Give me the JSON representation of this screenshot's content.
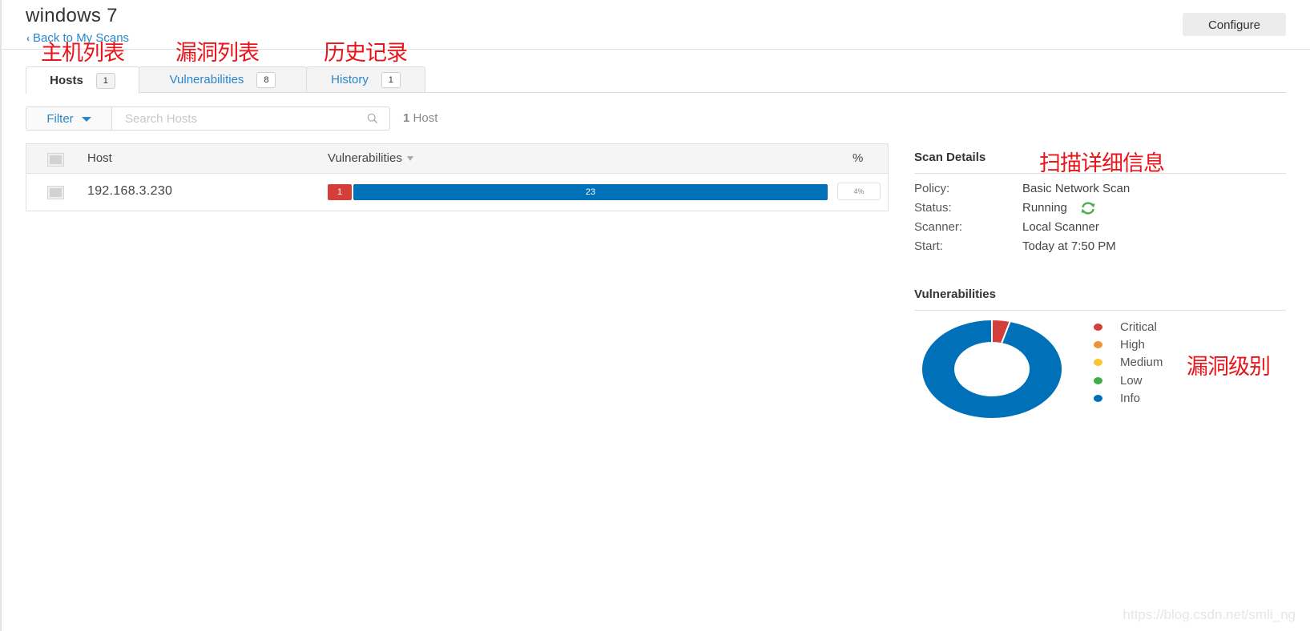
{
  "header": {
    "title": "windows 7",
    "back_link": "Back to My Scans",
    "configure_label": "Configure"
  },
  "annotations": {
    "hosts": "主机列表",
    "vulnerabilities": "漏洞列表",
    "history": "历史记录",
    "scan_details": "扫描详细信息",
    "severity": "漏洞级别"
  },
  "tabs": [
    {
      "label": "Hosts",
      "count": "1",
      "active": true
    },
    {
      "label": "Vulnerabilities",
      "count": "8",
      "active": false
    },
    {
      "label": "History",
      "count": "1",
      "active": false
    }
  ],
  "filter": {
    "label": "Filter",
    "search_placeholder": "Search Hosts",
    "search_value": "",
    "count_number": "1",
    "count_label": "Host"
  },
  "table": {
    "columns": [
      "Host",
      "Vulnerabilities",
      "%"
    ],
    "rows": [
      {
        "host": "192.168.3.230",
        "severity_counts": [
          {
            "severity": "Critical",
            "count": 1,
            "color": "#d43f3a"
          },
          {
            "severity": "Info",
            "count": 23,
            "color": "#0071b9"
          }
        ],
        "percent": "4%"
      }
    ]
  },
  "scan_details": {
    "title": "Scan Details",
    "fields": [
      {
        "label": "Policy:",
        "value": "Basic Network Scan"
      },
      {
        "label": "Status:",
        "value": "Running"
      },
      {
        "label": "Scanner:",
        "value": "Local Scanner"
      },
      {
        "label": "Start:",
        "value": "Today at 7:50 PM"
      }
    ],
    "status_icon": "refresh-icon",
    "status_color": "#4cae4c"
  },
  "vulnerabilities_panel": {
    "title": "Vulnerabilities"
  },
  "chart_data": {
    "type": "pie",
    "title": "Vulnerabilities",
    "donut": true,
    "legend_position": "right",
    "categories": [
      "Critical",
      "High",
      "Medium",
      "Low",
      "Info"
    ],
    "values": [
      1,
      0,
      0,
      0,
      23
    ],
    "colors": [
      "#d43f3a",
      "#ee9336",
      "#fdc431",
      "#3fae49",
      "#0071b9"
    ]
  },
  "watermark": "https://blog.csdn.net/smli_ng"
}
